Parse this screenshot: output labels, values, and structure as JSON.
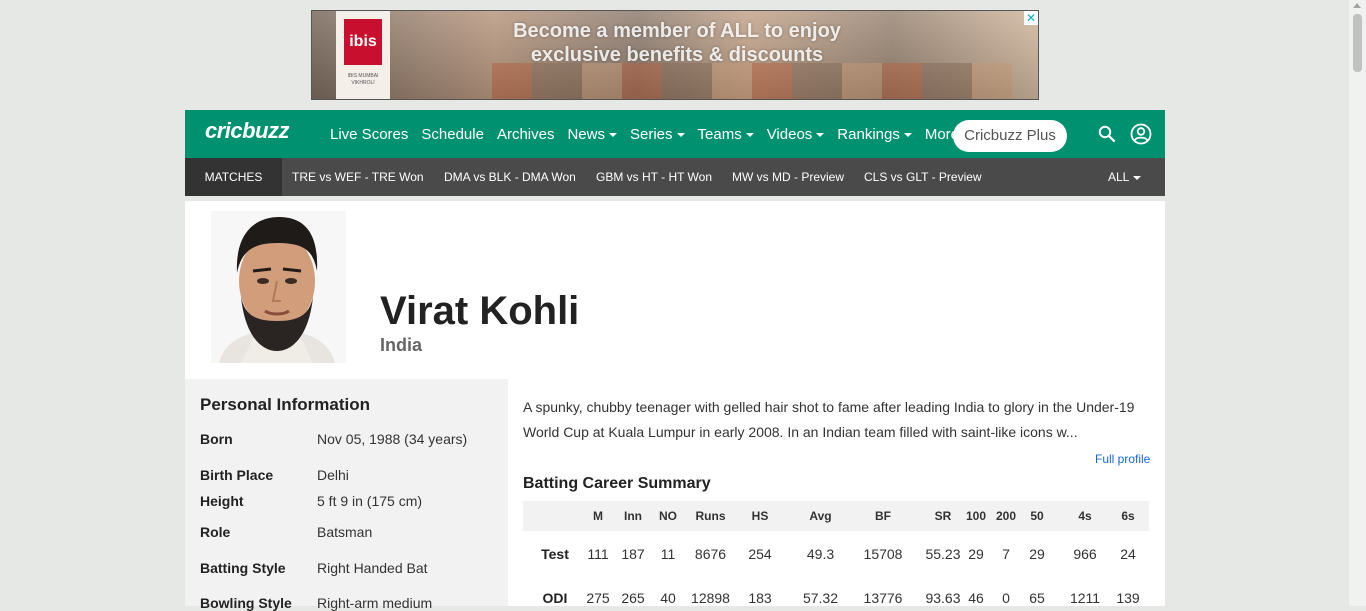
{
  "ad": {
    "logo_text": "ibis",
    "logo_subtext": "IBIS MUMBAI VIKHROLI",
    "headline": "Become a member of ALL to enjoy exclusive benefits & discounts",
    "close_glyph": "✕"
  },
  "header": {
    "brand": "cricbuzz",
    "nav": [
      {
        "label": "Live Scores",
        "dropdown": false
      },
      {
        "label": "Schedule",
        "dropdown": false
      },
      {
        "label": "Archives",
        "dropdown": false
      },
      {
        "label": "News",
        "dropdown": true
      },
      {
        "label": "Series",
        "dropdown": true
      },
      {
        "label": "Teams",
        "dropdown": true
      },
      {
        "label": "Videos",
        "dropdown": true
      },
      {
        "label": "Rankings",
        "dropdown": true
      },
      {
        "label": "More",
        "dropdown": true
      }
    ],
    "plus_label": "Cricbuzz Plus",
    "search_icon": "search-icon",
    "account_icon": "user-circle-icon",
    "color": "#009270"
  },
  "strip": {
    "matches_label": "MATCHES",
    "matches": [
      "TRE vs WEF - TRE Won",
      "DMA vs BLK - DMA Won",
      "GBM vs HT - HT Won",
      "MW vs MD - Preview",
      "CLS vs GLT - Preview"
    ],
    "all_label": "ALL"
  },
  "player": {
    "name": "Virat Kohli",
    "country": "India"
  },
  "personal": {
    "title": "Personal Information",
    "rows": [
      {
        "key": "Born",
        "value": "Nov 05, 1988 (34 years)"
      },
      {
        "key": "Birth Place",
        "value": "Delhi"
      },
      {
        "key": "Height",
        "value": "5 ft 9 in (175 cm)"
      },
      {
        "key": "Role",
        "value": "Batsman"
      },
      {
        "key": "Batting Style",
        "value": "Right Handed Bat"
      },
      {
        "key": "Bowling Style",
        "value": "Right-arm medium"
      }
    ]
  },
  "bio": {
    "text": "A spunky, chubby teenager with gelled hair shot to fame after leading India to glory in the Under-19 World Cup at Kuala Lumpur in early 2008. In an Indian team filled with saint-like icons w...",
    "full_profile": "Full profile"
  },
  "batting": {
    "title": "Batting Career Summary",
    "columns": [
      "",
      "M",
      "Inn",
      "NO",
      "Runs",
      "HS",
      "Avg",
      "BF",
      "SR",
      "100",
      "200",
      "50",
      "4s",
      "6s"
    ],
    "rows": [
      [
        "Test",
        "111",
        "187",
        "11",
        "8676",
        "254",
        "49.3",
        "15708",
        "55.23",
        "29",
        "7",
        "29",
        "966",
        "24"
      ],
      [
        "ODI",
        "275",
        "265",
        "40",
        "12898",
        "183",
        "57.32",
        "13776",
        "93.63",
        "46",
        "0",
        "65",
        "1211",
        "139"
      ]
    ]
  }
}
